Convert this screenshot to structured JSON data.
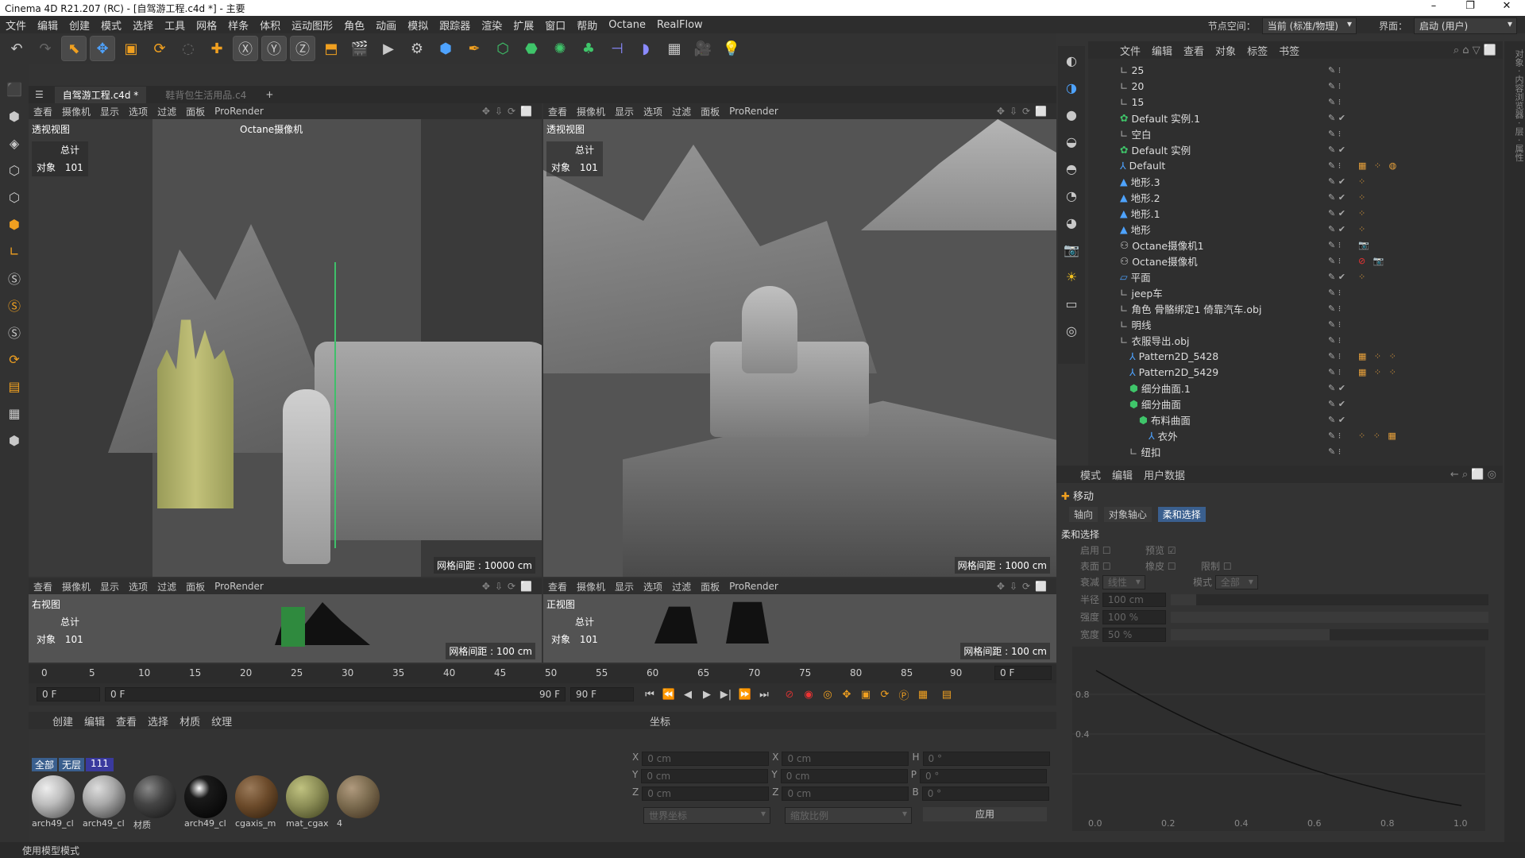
{
  "window": {
    "title": "Cinema 4D R21.207 (RC) - [自驾游工程.c4d *] - 主要",
    "controls": [
      "–",
      "❐",
      "✕"
    ]
  },
  "menu": [
    "文件",
    "编辑",
    "创建",
    "模式",
    "选择",
    "工具",
    "网格",
    "样条",
    "体积",
    "运动图形",
    "角色",
    "动画",
    "模拟",
    "跟踪器",
    "渲染",
    "扩展",
    "窗口",
    "帮助",
    "Octane",
    "RealFlow"
  ],
  "menu_right": {
    "node_space_label": "节点空间：",
    "node_space_value": "当前 (标准/物理)",
    "layout_label": "界面：",
    "layout_value": "启动 (用户)"
  },
  "documents": [
    {
      "name": "自驾游工程.c4d *",
      "active": true
    },
    {
      "name": "鞋背包生活用品.c4",
      "active": false
    }
  ],
  "viewport_menu": [
    "查看",
    "摄像机",
    "显示",
    "选项",
    "过滤",
    "面板",
    "ProRender"
  ],
  "viewports": {
    "tl": {
      "label": "透视视图",
      "camera": "Octane摄像机",
      "total_label": "总计",
      "obj_label": "对象",
      "obj_count": "101",
      "grid": "网格间距 : 10000 cm"
    },
    "tr": {
      "label": "透视视图",
      "total_label": "总计",
      "obj_label": "对象",
      "obj_count": "101",
      "grid": "网格间距 : 1000 cm"
    },
    "bl": {
      "label": "右视图",
      "total_label": "总计",
      "obj_label": "对象",
      "obj_count": "101",
      "grid": "网格间距 : 100 cm"
    },
    "br": {
      "label": "正视图",
      "total_label": "总计",
      "obj_label": "对象",
      "obj_count": "101",
      "grid": "网格间距 : 100 cm"
    }
  },
  "timeline": {
    "ticks": [
      "0",
      "5",
      "10",
      "15",
      "20",
      "25",
      "30",
      "35",
      "40",
      "45",
      "50",
      "55",
      "60",
      "65",
      "70",
      "75",
      "80",
      "85",
      "90"
    ],
    "current": "0 F"
  },
  "playbar": {
    "start": "0 F",
    "slider_start": "0 F",
    "slider_end": "90 F",
    "end": "90 F"
  },
  "materials": {
    "menu": [
      "创建",
      "编辑",
      "查看",
      "选择",
      "材质",
      "纹理"
    ],
    "filters": [
      "全部",
      "无层",
      "111"
    ],
    "items": [
      {
        "name": "arch49_cl",
        "color": "#bdbdbd"
      },
      {
        "name": "arch49_cl",
        "color": "#a9a9a9"
      },
      {
        "name": "材质",
        "color": "#444444"
      },
      {
        "name": "arch49_cl",
        "color": "#1a1a1a"
      },
      {
        "name": "cgaxis_m",
        "color": "#6b4a2a"
      },
      {
        "name": "mat_cgax",
        "color": "#8a8c55"
      },
      {
        "name": "4",
        "color": "#7a6a4e"
      }
    ]
  },
  "coords": {
    "title": "坐标",
    "rows": [
      {
        "a": "X",
        "av": "0 cm",
        "b": "X",
        "bv": "0 cm",
        "c": "H",
        "cv": "0 °"
      },
      {
        "a": "Y",
        "av": "0 cm",
        "b": "Y",
        "bv": "0 cm",
        "c": "P",
        "cv": "0 °"
      },
      {
        "a": "Z",
        "av": "0 cm",
        "b": "Z",
        "bv": "0 cm",
        "c": "B",
        "cv": "0 °"
      }
    ],
    "mode1": "世界坐标",
    "mode2": "缩放比例",
    "apply": "应用"
  },
  "object_manager": {
    "menu": [
      "文件",
      "编辑",
      "查看",
      "对象",
      "标签",
      "书签"
    ],
    "rows": [
      {
        "name": "25",
        "indent": 0
      },
      {
        "name": "20",
        "indent": 0
      },
      {
        "name": "15",
        "indent": 0
      },
      {
        "name": "Default 实例.1",
        "indent": 0
      },
      {
        "name": "空白",
        "indent": 0
      },
      {
        "name": "Default 实例",
        "indent": 0
      },
      {
        "name": "Default",
        "indent": 0
      },
      {
        "name": "地形.3",
        "indent": 0
      },
      {
        "name": "地形.2",
        "indent": 0
      },
      {
        "name": "地形.1",
        "indent": 0
      },
      {
        "name": "地形",
        "indent": 0
      },
      {
        "name": "Octane摄像机1",
        "indent": 0
      },
      {
        "name": "Octane摄像机",
        "indent": 0
      },
      {
        "name": "平面",
        "indent": 0
      },
      {
        "name": "jeep车",
        "indent": 0
      },
      {
        "name": "角色 骨骼绑定1 倚靠汽车.obj",
        "indent": 0
      },
      {
        "name": "明线",
        "indent": 0
      },
      {
        "name": "衣服导出.obj",
        "indent": 0
      },
      {
        "name": "Pattern2D_5428",
        "indent": 1
      },
      {
        "name": "Pattern2D_5429",
        "indent": 1
      },
      {
        "name": "细分曲面.1",
        "indent": 1
      },
      {
        "name": "细分曲面",
        "indent": 1
      },
      {
        "name": "布料曲面",
        "indent": 2
      },
      {
        "name": "衣外",
        "indent": 3
      },
      {
        "name": "纽扣",
        "indent": 1
      }
    ]
  },
  "attributes": {
    "menu": [
      "模式",
      "编辑",
      "用户数据"
    ],
    "tool": "移动",
    "tabs": [
      "轴向",
      "对象轴心",
      "柔和选择"
    ],
    "section": "柔和选择",
    "fields": {
      "enable": "启用",
      "preview": "预览",
      "surface": "表面",
      "rubber": "橡皮",
      "limit": "限制",
      "falloff_label": "衰减",
      "falloff_value": "线性",
      "mode_label": "模式",
      "mode_value": "全部",
      "radius_label": "半径",
      "radius_value": "100 cm",
      "strength_label": "强度",
      "strength_value": "100 %",
      "width_label": "宽度",
      "width_value": "50 %"
    },
    "graph_y": [
      "0.8",
      "0.4"
    ],
    "graph_x": [
      "0.0",
      "0.2",
      "0.4",
      "0.6",
      "0.8",
      "1.0"
    ]
  },
  "status": "使用模型模式"
}
